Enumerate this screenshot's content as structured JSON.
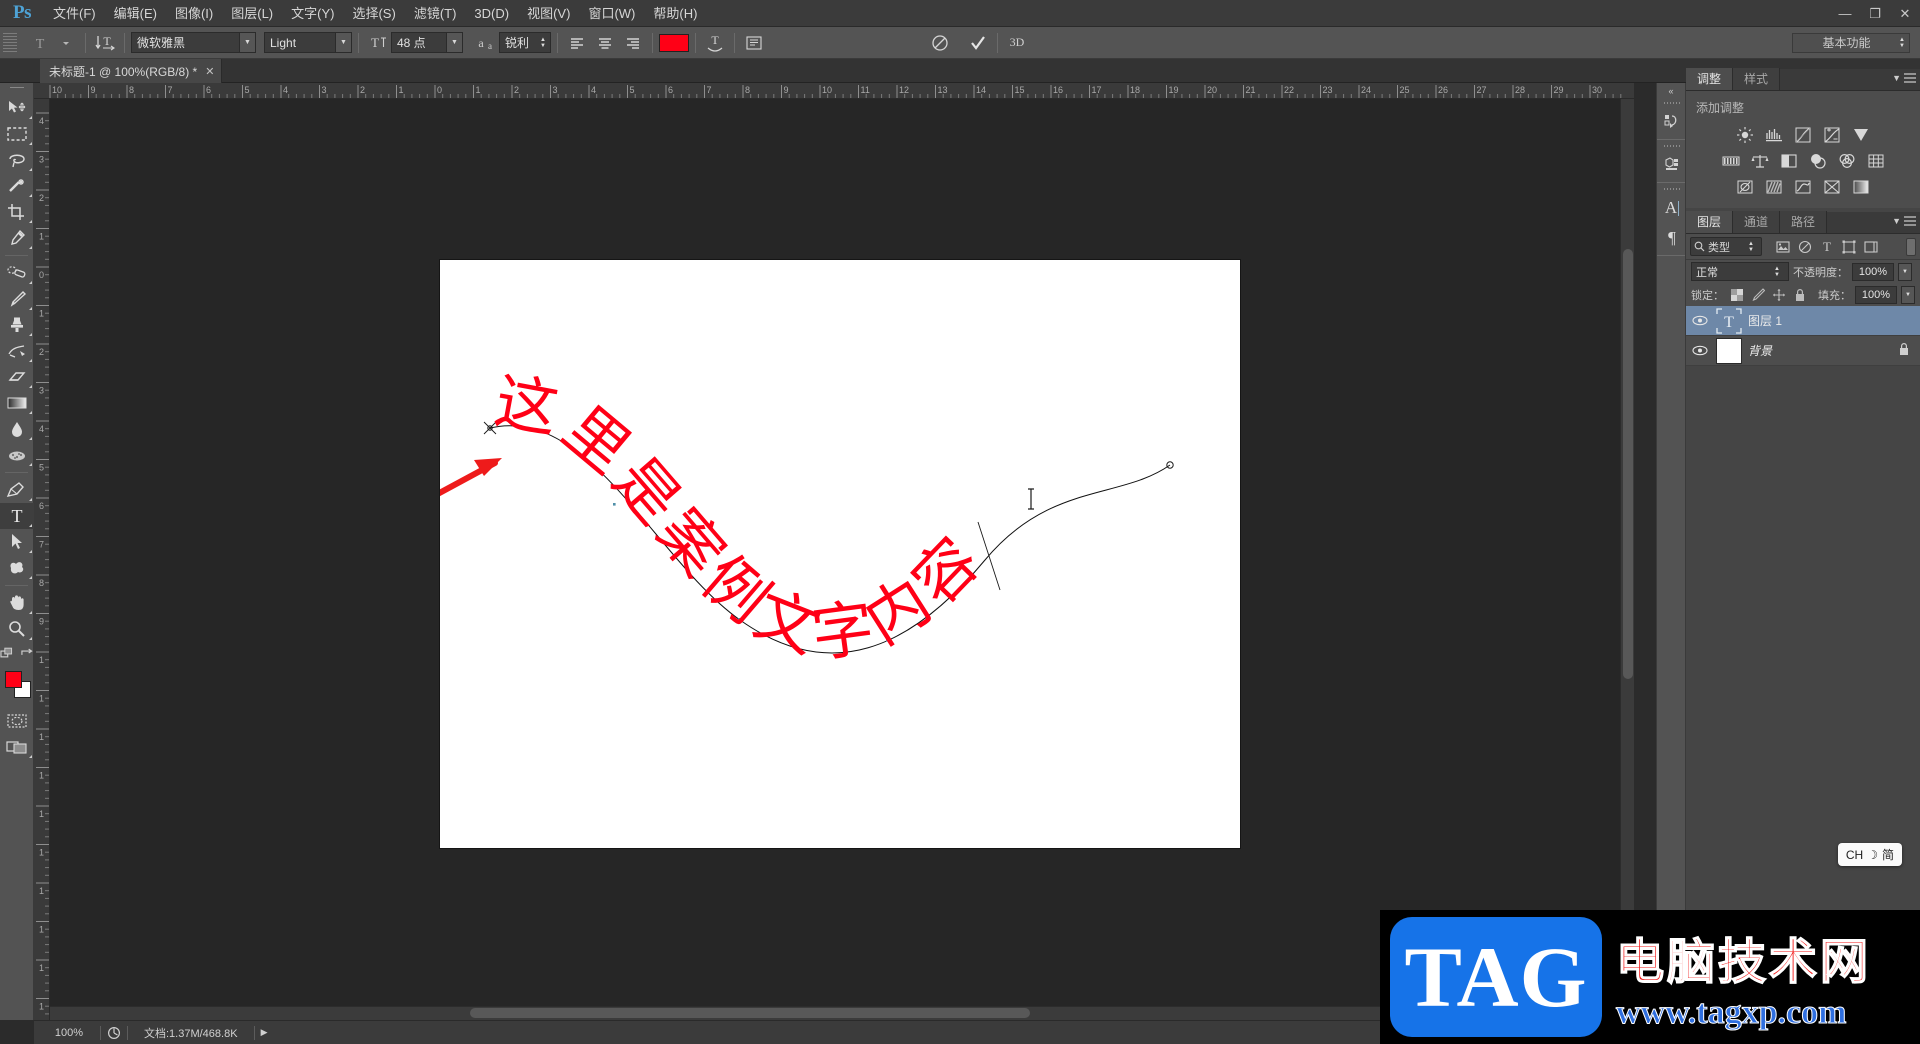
{
  "app": {
    "logo": "Ps",
    "workspace": "基本功能"
  },
  "menubar": {
    "items": [
      {
        "label": "文件(F)"
      },
      {
        "label": "编辑(E)"
      },
      {
        "label": "图像(I)"
      },
      {
        "label": "图层(L)"
      },
      {
        "label": "文字(Y)"
      },
      {
        "label": "选择(S)"
      },
      {
        "label": "滤镜(T)"
      },
      {
        "label": "3D(D)"
      },
      {
        "label": "视图(V)"
      },
      {
        "label": "窗口(W)"
      },
      {
        "label": "帮助(H)"
      }
    ],
    "window_controls": {
      "minimize": "—",
      "restore": "❐",
      "close": "✕"
    }
  },
  "options_bar": {
    "tool_preset_icon": "type-tool-preset-icon",
    "orientation_icon": "toggle-text-orientation-icon",
    "font_family": "微软雅黑",
    "font_style": "Light",
    "font_size": "48 点",
    "anti_alias_label": "aa",
    "anti_alias_value": "锐利",
    "align_left": "align-left-icon",
    "align_center": "align-center-icon",
    "align_right": "align-right-icon",
    "text_color": "#ff0016",
    "warp_icon": "create-warped-text-icon",
    "panels_icon": "toggle-character-paragraph-panels-icon",
    "cancel_icon": "cancel-edits-icon",
    "commit_icon": "commit-edits-icon",
    "threeD_label": "3D"
  },
  "document": {
    "tab_title": "未标题-1 @ 100%(RGB/8) *",
    "close_glyph": "✕"
  },
  "tools": [
    {
      "name": "move-tool",
      "glyph": "move"
    },
    {
      "name": "rectangular-marquee-tool",
      "glyph": "marquee"
    },
    {
      "name": "lasso-tool",
      "glyph": "lasso"
    },
    {
      "name": "quick-selection-tool",
      "glyph": "wand"
    },
    {
      "name": "crop-tool",
      "glyph": "crop"
    },
    {
      "name": "eyedropper-tool",
      "glyph": "eyedropper"
    },
    {
      "name": "spot-healing-brush-tool",
      "glyph": "healing"
    },
    {
      "name": "brush-tool",
      "glyph": "brush"
    },
    {
      "name": "clone-stamp-tool",
      "glyph": "stamp"
    },
    {
      "name": "history-brush-tool",
      "glyph": "historybrush"
    },
    {
      "name": "eraser-tool",
      "glyph": "eraser"
    },
    {
      "name": "gradient-tool",
      "glyph": "gradient"
    },
    {
      "name": "blur-tool",
      "glyph": "blur"
    },
    {
      "name": "dodge-tool",
      "glyph": "dodge"
    },
    {
      "name": "pen-tool",
      "glyph": "pen"
    },
    {
      "name": "horizontal-type-tool",
      "glyph": "T",
      "selected": true
    },
    {
      "name": "path-selection-tool",
      "glyph": "arrowsel"
    },
    {
      "name": "custom-shape-tool",
      "glyph": "shape"
    },
    {
      "name": "hand-tool",
      "glyph": "hand"
    },
    {
      "name": "zoom-tool",
      "glyph": "zoom"
    }
  ],
  "tool_footer": {
    "foreground_color": "#ff0016",
    "background_color": "#ffffff",
    "quick_mask": "quick-mask-icon",
    "screen_mode": "screen-mode-icon"
  },
  "ruler": {
    "unit_hint": "cm",
    "horizontal_labels": [
      "10",
      "9",
      "8",
      "7",
      "6",
      "5",
      "4",
      "3",
      "2",
      "1",
      "0",
      "1",
      "2",
      "3",
      "4",
      "5",
      "6",
      "7",
      "8",
      "9",
      "10",
      "11",
      "12",
      "13",
      "14",
      "15",
      "16",
      "17",
      "18",
      "19",
      "20",
      "21",
      "22",
      "23",
      "24",
      "25",
      "26",
      "27",
      "28",
      "29",
      "30"
    ],
    "vertical_labels": [
      "4",
      "3",
      "2",
      "1",
      "0",
      "1",
      "2",
      "3",
      "4",
      "5",
      "6",
      "7",
      "8",
      "9",
      "1",
      "1",
      "1",
      "1",
      "1",
      "1",
      "1",
      "1",
      "1",
      "1"
    ]
  },
  "canvas": {
    "text_on_path": "这里是案例文字内容",
    "text_color": "#ff0016",
    "path_stroke": "#111111",
    "annotation_arrow_color": "#ee1b1b",
    "cursor": "I-beam-text-cursor"
  },
  "statusbar": {
    "zoom": "100%",
    "doc_icon": "document-info-icon",
    "doc_info": "文档:1.37M/468.8K",
    "more_glyph": "▶"
  },
  "dock_icons": [
    {
      "name": "history-panel-icon",
      "glyph": "history"
    },
    {
      "name": "mini-bridge-panel-icon",
      "glyph": "bridge"
    },
    {
      "name": "character-panel-icon",
      "glyph": "A"
    },
    {
      "name": "paragraph-panel-icon",
      "glyph": "¶"
    }
  ],
  "adjustments_panel": {
    "tabs": [
      {
        "label": "调整",
        "active": true
      },
      {
        "label": "样式",
        "active": false
      }
    ],
    "title": "添加调整",
    "rows": [
      [
        {
          "name": "brightness-contrast-adjustment",
          "glyph": "☀"
        },
        {
          "name": "levels-adjustment",
          "glyph": "levels"
        },
        {
          "name": "curves-adjustment",
          "glyph": "curves"
        },
        {
          "name": "exposure-adjustment",
          "glyph": "exposure"
        },
        {
          "name": "vibrance-adjustment",
          "glyph": "▼"
        }
      ],
      [
        {
          "name": "hue-saturation-adjustment",
          "glyph": "huesat"
        },
        {
          "name": "color-balance-adjustment",
          "glyph": "balance"
        },
        {
          "name": "black-white-adjustment",
          "glyph": "bw"
        },
        {
          "name": "photo-filter-adjustment",
          "glyph": "photofilter"
        },
        {
          "name": "channel-mixer-adjustment",
          "glyph": "mixer"
        },
        {
          "name": "color-lookup-adjustment",
          "glyph": "lookup"
        }
      ],
      [
        {
          "name": "invert-adjustment",
          "glyph": "invert"
        },
        {
          "name": "posterize-adjustment",
          "glyph": "posterize"
        },
        {
          "name": "threshold-adjustment",
          "glyph": "threshold"
        },
        {
          "name": "selective-color-adjustment",
          "glyph": "selective"
        },
        {
          "name": "gradient-map-adjustment",
          "glyph": "gradmap"
        }
      ]
    ]
  },
  "layers_panel": {
    "tabs": [
      {
        "label": "图层",
        "active": true
      },
      {
        "label": "通道",
        "active": false
      },
      {
        "label": "路径",
        "active": false
      }
    ],
    "filter": {
      "search_icon": "search-icon",
      "type_label": "类型",
      "icons": [
        {
          "name": "filter-pixel-layers-icon",
          "glyph": "pixel"
        },
        {
          "name": "filter-adjustment-layers-icon",
          "glyph": "adj"
        },
        {
          "name": "filter-type-layers-icon",
          "glyph": "T"
        },
        {
          "name": "filter-shape-layers-icon",
          "glyph": "shape"
        },
        {
          "name": "filter-smart-objects-icon",
          "glyph": "smart"
        }
      ]
    },
    "blend_mode": "正常",
    "opacity_label": "不透明度：",
    "opacity_value": "100%",
    "lock_label": "锁定：",
    "lock_icons": [
      {
        "name": "lock-transparent-pixels-icon",
        "glyph": "▦"
      },
      {
        "name": "lock-image-pixels-icon",
        "glyph": "brush"
      },
      {
        "name": "lock-position-icon",
        "glyph": "✛"
      },
      {
        "name": "lock-all-icon",
        "glyph": "🔒"
      }
    ],
    "fill_label": "填充：",
    "fill_value": "100%",
    "layers": [
      {
        "name": "图层 1",
        "type": "type-layer",
        "visible": true,
        "selected": true,
        "locked": false
      },
      {
        "name": "背景",
        "type": "background-layer",
        "visible": true,
        "selected": false,
        "locked": true
      }
    ]
  },
  "ime_badge": {
    "lang": "CH",
    "moon": "☽",
    "mode": "简"
  },
  "watermark": {
    "logo_text": "TAG",
    "site_name_cn": "电脑技术网",
    "site_url": "www.tagxp.com",
    "logo_bg": "#1673e8",
    "name_color": "#f21616",
    "url_color": "#2f6fe0"
  }
}
